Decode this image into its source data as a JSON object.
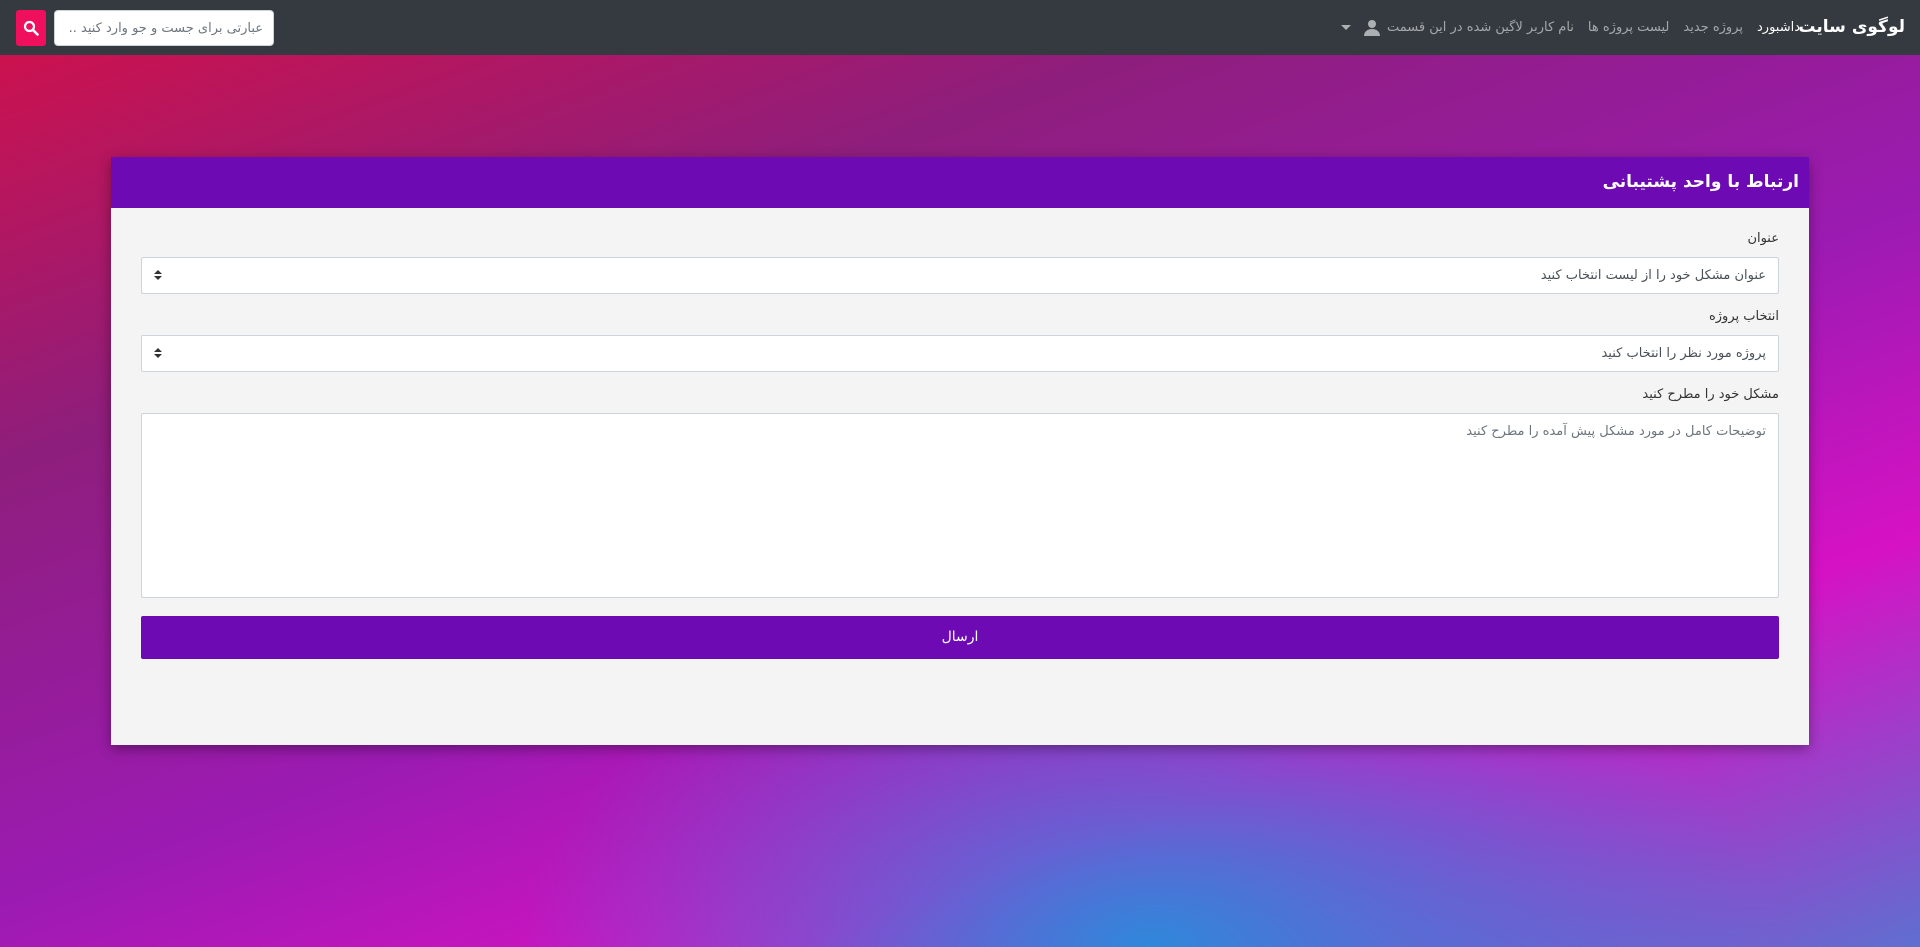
{
  "navbar": {
    "brand": "لوگوی سایت",
    "links": {
      "dashboard": "داشبورد",
      "new_project": "پروژه جدید",
      "project_list": "لیست پروژه ها",
      "user": "نام کاربر لاگین شده در این قسمت"
    },
    "search_placeholder": "عبارتی برای جست و جو وارد کنید .."
  },
  "support": {
    "title": "ارتباط با واحد پشتیبانی",
    "subject_label": "عنوان",
    "subject_selected": "عنوان مشکل خود را از لیست انتخاب کنید",
    "project_label": "انتخاب پروژه",
    "project_selected": "پروژه مورد نظر را انتخاب کنید",
    "problem_label": "مشکل خود را مطرح کنید",
    "problem_placeholder": "توضیحات کامل در مورد مشکل پیش آمده را مطرح کنید",
    "submit_label": "ارسال"
  },
  "colors": {
    "navbar": "#343a40",
    "accent": "#6d0ab4",
    "search_button": "#ef0f5d"
  }
}
